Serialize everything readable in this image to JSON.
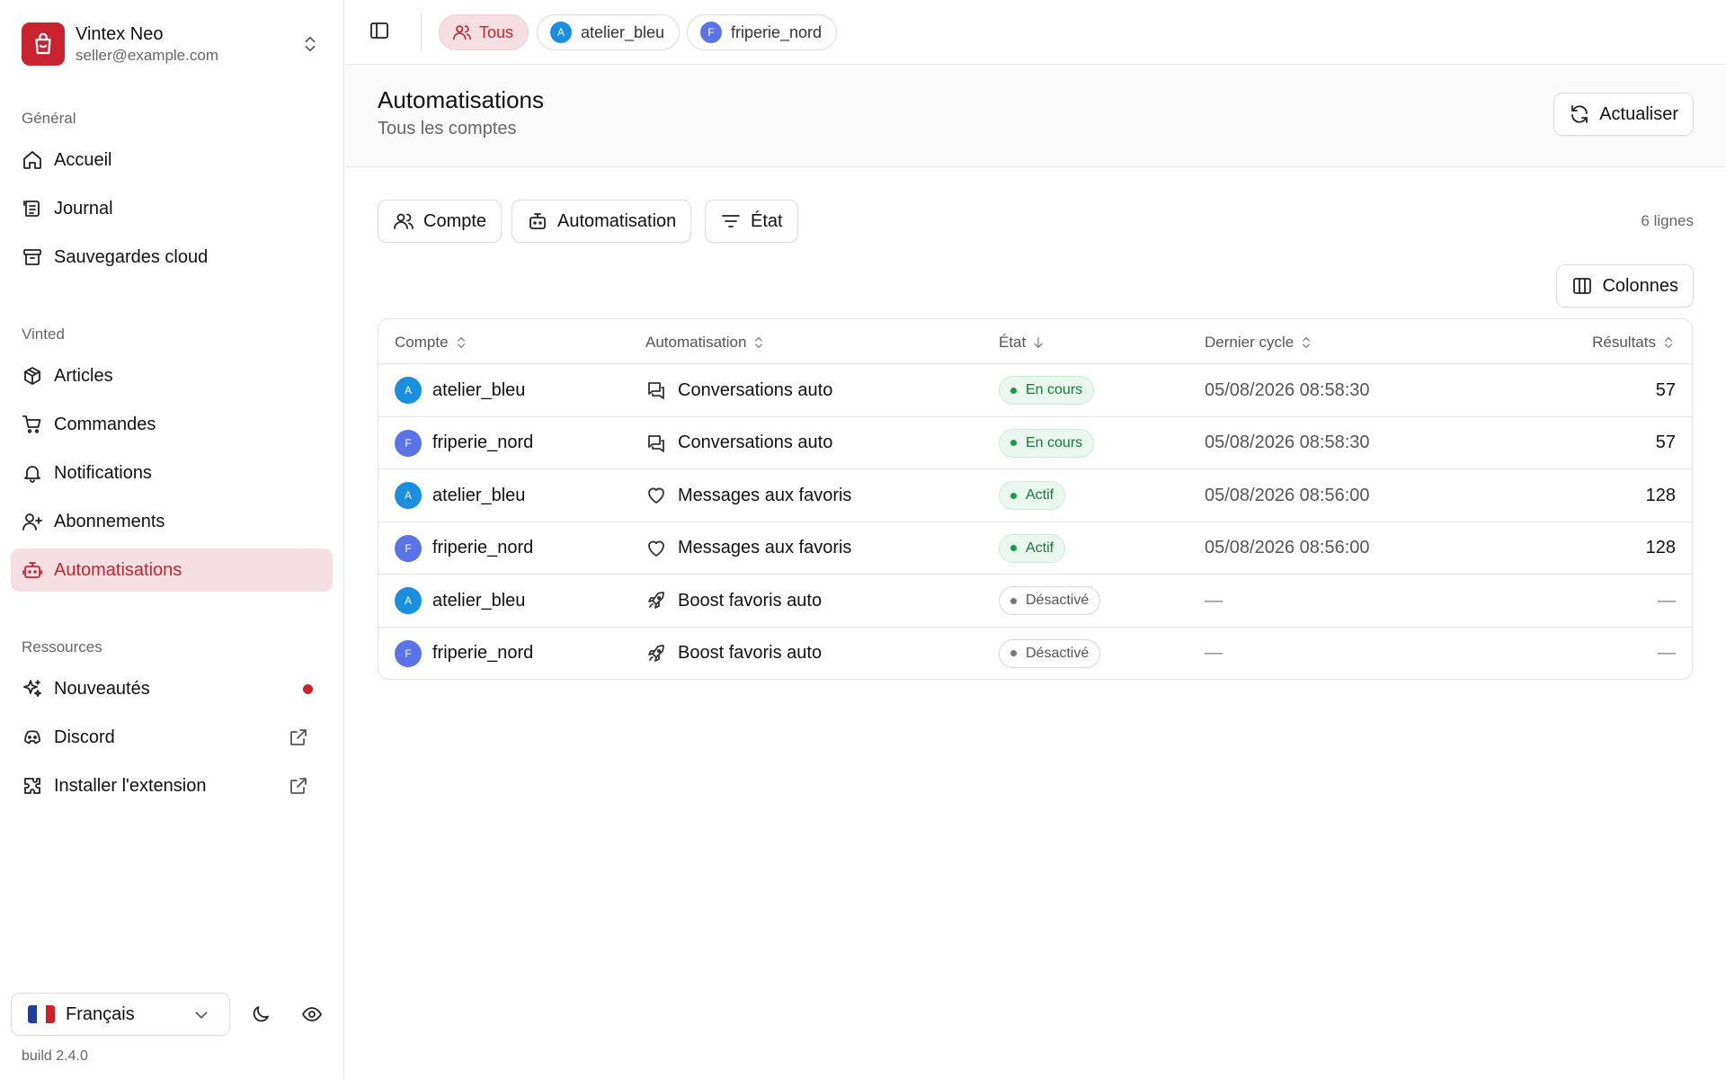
{
  "brand": {
    "name": "Vintex Neo",
    "email": "seller@example.com"
  },
  "sidebar": {
    "sections": [
      {
        "label": "Général",
        "items": [
          {
            "label": "Accueil",
            "icon": "home-icon"
          },
          {
            "label": "Journal",
            "icon": "journal-icon"
          },
          {
            "label": "Sauvegardes cloud",
            "icon": "archive-icon"
          }
        ]
      },
      {
        "label": "Vinted",
        "items": [
          {
            "label": "Articles",
            "icon": "package-icon"
          },
          {
            "label": "Commandes",
            "icon": "cart-icon"
          },
          {
            "label": "Notifications",
            "icon": "bell-icon"
          },
          {
            "label": "Abonnements",
            "icon": "user-plus-icon"
          },
          {
            "label": "Automatisations",
            "icon": "bot-icon",
            "active": true
          }
        ]
      },
      {
        "label": "Ressources",
        "items": [
          {
            "label": "Nouveautés",
            "icon": "sparkles-icon"
          },
          {
            "label": "Discord",
            "icon": "discord-icon"
          },
          {
            "label": "Installer l'extension",
            "icon": "puzzle-icon"
          }
        ]
      }
    ],
    "language": "Français",
    "build": "build 2.4.0"
  },
  "topbar": {
    "chips": [
      {
        "label": "Tous",
        "active": true
      },
      {
        "label": "atelier_bleu",
        "initial": "A"
      },
      {
        "label": "friperie_nord",
        "initial": "F"
      }
    ]
  },
  "header": {
    "title": "Automatisations",
    "subtitle": "Tous les comptes",
    "refresh_label": "Actualiser"
  },
  "filters": {
    "account": "Compte",
    "automation": "Automatisation",
    "state": "État",
    "row_count": "6 lignes",
    "columns": "Colonnes"
  },
  "table": {
    "columns": [
      "Compte",
      "Automatisation",
      "État",
      "Dernier cycle",
      "Résultats"
    ],
    "rows": [
      {
        "account": "atelier_bleu",
        "initial": "A",
        "automation": "Conversations auto",
        "auto_icon": "chat-icon",
        "state": "En cours",
        "state_kind": "green",
        "last_cycle": "05/08/2026 08:58:30",
        "results": "57"
      },
      {
        "account": "friperie_nord",
        "initial": "F",
        "automation": "Conversations auto",
        "auto_icon": "chat-icon",
        "state": "En cours",
        "state_kind": "green",
        "last_cycle": "05/08/2026 08:58:30",
        "results": "57"
      },
      {
        "account": "atelier_bleu",
        "initial": "A",
        "automation": "Messages aux favoris",
        "auto_icon": "heart-icon",
        "state": "Actif",
        "state_kind": "green",
        "last_cycle": "05/08/2026 08:56:00",
        "results": "128"
      },
      {
        "account": "friperie_nord",
        "initial": "F",
        "automation": "Messages aux favoris",
        "auto_icon": "heart-icon",
        "state": "Actif",
        "state_kind": "green",
        "last_cycle": "05/08/2026 08:56:00",
        "results": "128"
      },
      {
        "account": "atelier_bleu",
        "initial": "A",
        "automation": "Boost favoris auto",
        "auto_icon": "rocket-icon",
        "state": "Désactivé",
        "state_kind": "gray",
        "last_cycle": "—",
        "results": "—"
      },
      {
        "account": "friperie_nord",
        "initial": "F",
        "automation": "Boost favoris auto",
        "auto_icon": "rocket-icon",
        "state": "Désactivé",
        "state_kind": "gray",
        "last_cycle": "—",
        "results": "—"
      }
    ]
  },
  "colors": {
    "accent": "#c8232f",
    "accent_soft": "#f6dfe2",
    "avatar_a": "#1a8fe0",
    "avatar_f": "#5a74e8"
  }
}
